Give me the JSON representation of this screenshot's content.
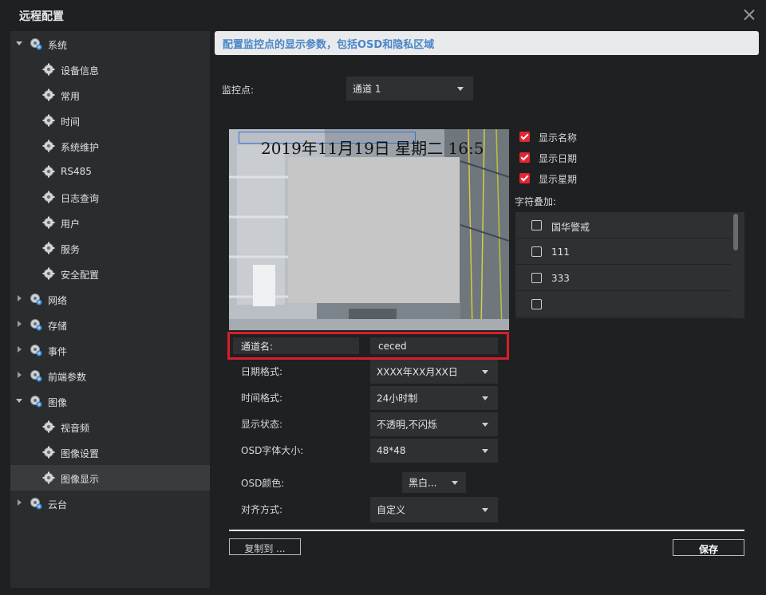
{
  "window": {
    "title": "远程配置"
  },
  "sidebar": {
    "items": [
      {
        "label": "系统",
        "level": 0,
        "expanded": true,
        "icon": "gear-globe-icon"
      },
      {
        "label": "设备信息",
        "level": 1,
        "icon": "gear-icon"
      },
      {
        "label": "常用",
        "level": 1,
        "icon": "gear-icon"
      },
      {
        "label": "时间",
        "level": 1,
        "icon": "gear-icon"
      },
      {
        "label": "系统维护",
        "level": 1,
        "icon": "gear-icon"
      },
      {
        "label": "RS485",
        "level": 1,
        "icon": "gear-icon"
      },
      {
        "label": "日志查询",
        "level": 1,
        "icon": "gear-icon"
      },
      {
        "label": "用户",
        "level": 1,
        "icon": "gear-icon"
      },
      {
        "label": "服务",
        "level": 1,
        "icon": "gear-icon"
      },
      {
        "label": "安全配置",
        "level": 1,
        "icon": "gear-icon"
      },
      {
        "label": "网络",
        "level": 0,
        "expanded": false,
        "icon": "gear-globe-icon"
      },
      {
        "label": "存储",
        "level": 0,
        "expanded": false,
        "icon": "gear-globe-icon"
      },
      {
        "label": "事件",
        "level": 0,
        "expanded": false,
        "icon": "gear-globe-icon"
      },
      {
        "label": "前端参数",
        "level": 0,
        "expanded": false,
        "icon": "gear-globe-icon"
      },
      {
        "label": "图像",
        "level": 0,
        "expanded": true,
        "icon": "gear-globe-icon"
      },
      {
        "label": "视音频",
        "level": 1,
        "icon": "gear-icon"
      },
      {
        "label": "图像设置",
        "level": 1,
        "icon": "gear-icon"
      },
      {
        "label": "图像显示",
        "level": 1,
        "icon": "gear-icon",
        "selected": true
      },
      {
        "label": "云台",
        "level": 0,
        "expanded": false,
        "icon": "gear-globe-icon"
      }
    ]
  },
  "banner": {
    "text": "配置监控点的显示参数，包括OSD和隐私区域"
  },
  "monitor": {
    "label": "监控点:",
    "value": "通道 1"
  },
  "preview": {
    "osd_text": "2019年11月19日 星期二 16:5"
  },
  "checks": [
    {
      "label": "显示名称",
      "checked": true
    },
    {
      "label": "显示日期",
      "checked": true
    },
    {
      "label": "显示星期",
      "checked": true
    }
  ],
  "overlay": {
    "label": "字符叠加:",
    "items": [
      {
        "text": "国华警戒",
        "checked": false
      },
      {
        "text": "111",
        "checked": false
      },
      {
        "text": "333",
        "checked": false
      },
      {
        "text": "",
        "checked": false
      }
    ]
  },
  "form": {
    "channel_name_label": "通道名:",
    "channel_name_value": "ceced",
    "date_format_label": "日期格式:",
    "date_format_value": "XXXX年XX月XX日",
    "time_format_label": "时间格式:",
    "time_format_value": "24小时制",
    "display_state_label": "显示状态:",
    "display_state_value": "不透明,不闪烁",
    "osd_font_label": "OSD字体大小:",
    "osd_font_value": "48*48",
    "osd_color_label": "OSD颜色:",
    "osd_color_value": "黑白...",
    "align_label": "对齐方式:",
    "align_value": "自定义"
  },
  "buttons": {
    "copy": "复制到 ...",
    "save": "保存"
  },
  "colors": {
    "accent": "#e5252f",
    "banner_text": "#4a86c8",
    "highlight_border": "#d81e2a"
  }
}
